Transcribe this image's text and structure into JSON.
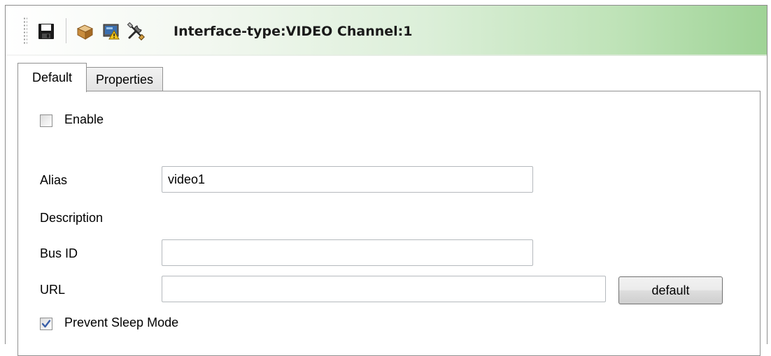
{
  "toolbar": {
    "title": "Interface-type:VIDEO Channel:1",
    "icons": [
      "save-icon",
      "package-icon",
      "monitor-warning-icon",
      "tools-icon"
    ]
  },
  "tabs": [
    {
      "label": "Default",
      "active": true
    },
    {
      "label": "Properties",
      "active": false
    }
  ],
  "form": {
    "enable": {
      "label": "Enable",
      "checked": false
    },
    "alias": {
      "label": "Alias",
      "value": "video1"
    },
    "description": {
      "label": "Description"
    },
    "bus_id": {
      "label": "Bus ID",
      "value": ""
    },
    "url": {
      "label": "URL",
      "value": ""
    },
    "default_button": "default",
    "prevent_sleep": {
      "label": "Prevent Sleep Mode",
      "checked": true
    }
  },
  "colors": {
    "toolbar_gradient_end": "#9fd396",
    "checkmark": "#3a5fa8"
  }
}
